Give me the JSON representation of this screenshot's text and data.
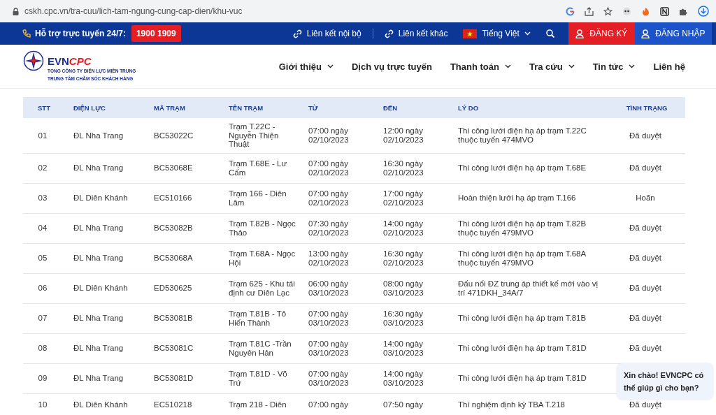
{
  "browser": {
    "url": "cskh.cpc.vn/tra-cuu/lich-tam-ngung-cung-cap-dien/khu-vuc"
  },
  "topbar": {
    "support_label": "Hỗ trợ trực tuyến 24/7:",
    "hotline": "1900 1909",
    "links": [
      "Liên kết nội bộ",
      "Liên kết khác"
    ],
    "language": "Tiếng Việt",
    "register": "ĐĂNG KÝ",
    "login": "ĐĂNG NHẬP"
  },
  "header": {
    "logo": {
      "main": "EVN",
      "accent": "CPC"
    },
    "org_lines": [
      "TỔNG CÔNG TY ĐIỆN LỰC MIỀN TRUNG",
      "TRUNG TÂM CHĂM SÓC KHÁCH HÀNG"
    ],
    "nav": [
      {
        "label": "Giới thiệu",
        "kind": "dropdown"
      },
      {
        "label": "Dịch vụ trực tuyến",
        "kind": "link"
      },
      {
        "label": "Thanh toán",
        "kind": "dropdown"
      },
      {
        "label": "Tra cứu",
        "kind": "dropdown"
      },
      {
        "label": "Tin tức",
        "kind": "dropdown"
      },
      {
        "label": "Liên hệ",
        "kind": "link"
      }
    ]
  },
  "table": {
    "columns": [
      "STT",
      "ĐIỆN LỰC",
      "MÃ TRẠM",
      "TÊN TRẠM",
      "TỪ",
      "ĐẾN",
      "LÝ DO",
      "TÌNH TRẠNG"
    ],
    "rows": [
      [
        "01",
        "ĐL Nha Trang",
        "BC53022C",
        "Trạm T.22C - Nguyễn Thiện Thuật",
        "07:00 ngày 02/10/2023",
        "12:00 ngày 02/10/2023",
        "Thi công lưới điện hạ áp trạm T.22C thuộc tuyến 474MVO",
        "Đã duyệt"
      ],
      [
        "02",
        "ĐL Nha Trang",
        "BC53068E",
        "Trạm T.68E - Lư Cấm",
        "07:00 ngày 02/10/2023",
        "16:30 ngày 02/10/2023",
        "Thi công lưới điện hạ áp trạm T.68E",
        "Đã duyệt"
      ],
      [
        "03",
        "ĐL Diên Khánh",
        "EC510166",
        "Trạm 166 - Diên Lâm",
        "07:00 ngày 02/10/2023",
        "17:00 ngày 02/10/2023",
        "Hoàn thiện lưới hạ áp trạm T.166",
        "Hoãn"
      ],
      [
        "04",
        "ĐL Nha Trang",
        "BC53082B",
        "Trạm T.82B - Ngọc Thảo",
        "07:30 ngày 02/10/2023",
        "14:00 ngày 02/10/2023",
        "Thi công lưới điện hạ áp trạm T.82B thuộc tuyến 479MVO",
        "Đã duyệt"
      ],
      [
        "05",
        "ĐL Nha Trang",
        "BC53068A",
        "Trạm T.68A - Ngọc Hội",
        "13:00 ngày 02/10/2023",
        "16:30 ngày 02/10/2023",
        "Thi công lưới điện hạ áp trạm T.68A thuộc tuyến 479MVO",
        "Đã duyệt"
      ],
      [
        "06",
        "ĐL Diên Khánh",
        "ED530625",
        "Trạm 625 - Khu tái định cư Diên Lạc",
        "06:00 ngày 03/10/2023",
        "08:00 ngày 03/10/2023",
        "Đấu nối ĐZ trung áp thiết kế mới vào vị trí 471DKH_34A/7",
        "Đã duyệt"
      ],
      [
        "07",
        "ĐL Nha Trang",
        "BC53081B",
        "Trạm T.81B - Tô Hiến Thành",
        "07:00 ngày 03/10/2023",
        "16:30 ngày 03/10/2023",
        "Thi công lưới điện hạ áp trạm T.81B",
        "Đã duyệt"
      ],
      [
        "08",
        "ĐL Nha Trang",
        "BC53081C",
        "Trạm T.81C -Trần Nguyên Hản",
        "07:00 ngày 03/10/2023",
        "14:00 ngày 03/10/2023",
        "Thi công lưới điện hạ áp trạm T.81D",
        "Đã duyệt"
      ],
      [
        "09",
        "ĐL Nha Trang",
        "BC53081D",
        "Trạm T.81D - Võ Trứ",
        "07:00 ngày 03/10/2023",
        "14:00 ngày 03/10/2023",
        "Thi công lưới điện hạ áp trạm T.81D"
      ],
      [
        "10",
        "ĐL Diên Khánh",
        "EC510218",
        "Trạm 218 - Diên",
        "07:00 ngày",
        "07:50 ngày",
        "Thí nghiệm định kỳ TBA T.218",
        "Đã duyệt"
      ]
    ]
  },
  "chat": {
    "message": "Xin chào! EVNCPC có thể giúp gì cho bạn?"
  }
}
